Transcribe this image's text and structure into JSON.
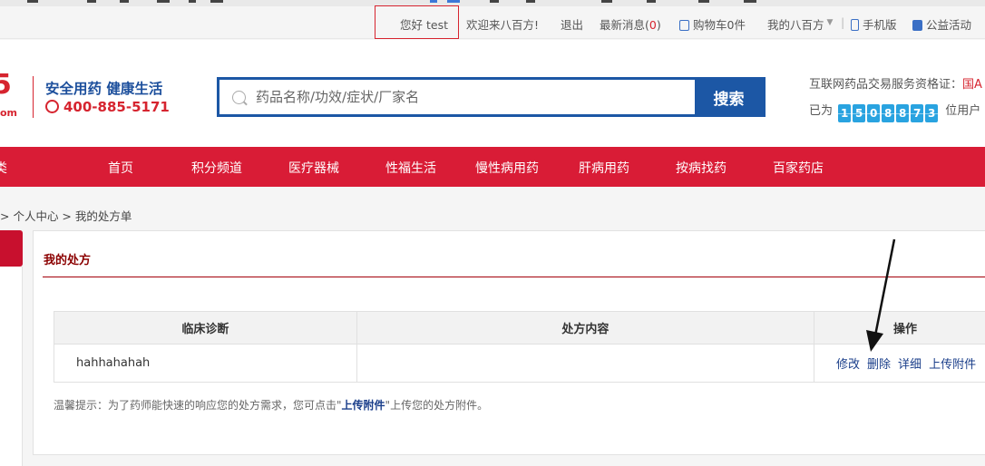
{
  "topbar": {
    "greeting": "您好 test",
    "welcome": "欢迎来八百方!",
    "logout": "退出",
    "news_label": "最新消息(",
    "news_count": "0",
    "news_close": ")",
    "cart": "购物车0件",
    "my_account": "我的八百方",
    "mobile": "手机版",
    "charity": "公益活动"
  },
  "header": {
    "logo_char": "5",
    "logo_suffix": "om",
    "slogan": "安全用药 健康生活",
    "hotline": "400-885-5171",
    "search_placeholder": "药品名称/功效/症状/厂家名",
    "search_button": "搜索",
    "cert_label": "互联网药品交易服务资格证：",
    "cert_value": "国A",
    "served_prefix": "已为",
    "served_digits": [
      "1",
      "5",
      "0",
      "8",
      "8",
      "7",
      "3"
    ],
    "served_suffix": "位用户"
  },
  "nav": {
    "partial": "类",
    "items": [
      "首页",
      "积分频道",
      "医疗器械",
      "性福生活",
      "慢性病用药",
      "肝病用药",
      "按病找药",
      "百家药店"
    ]
  },
  "breadcrumb": "> 个人中心 > 我的处方单",
  "panel": {
    "title": "我的处方",
    "columns": [
      "临床诊断",
      "处方内容",
      "操作"
    ],
    "rows": [
      {
        "diagnosis": "hahhahahah",
        "content": "",
        "actions": [
          "修改",
          "删除",
          "详细",
          "上传附件"
        ]
      }
    ],
    "tip_prefix": "温馨提示：为了药师能快速的响应您的处方需求，您可点击\"",
    "tip_link": "上传附件",
    "tip_suffix": "\"上传您的处方附件。"
  },
  "colors": {
    "brand_red": "#d91c36",
    "brand_blue": "#1c57a5",
    "digit_blue": "#29a3e0"
  }
}
